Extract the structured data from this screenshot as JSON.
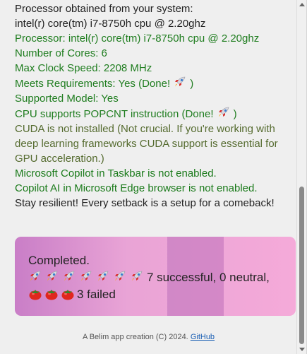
{
  "log": [
    {
      "text": "Processor obtained from your system:",
      "color": "#222222"
    },
    {
      "text": "intel(r) core(tm) i7-8750h cpu @ 2.20ghz",
      "color": "#222222"
    },
    {
      "text": "Processor: intel(r) core(tm) i7-8750h cpu @ 2.20ghz",
      "color": "#1f7d1f"
    },
    {
      "text": "Number of Cores: 6",
      "color": "#1f7d1f"
    },
    {
      "text": "Max Clock Speed: 2208 MHz",
      "color": "#1f7d1f"
    },
    {
      "text": "Meets Requirements: Yes (Done! ",
      "suffix": ")",
      "icon": "rocket-icon",
      "color": "#1f7d1f"
    },
    {
      "text": "Supported Model: Yes",
      "color": "#1f7d1f"
    },
    {
      "text": "CPU supports POPCNT instruction (Done! ",
      "suffix": ")",
      "icon": "rocket-icon",
      "color": "#1f7d1f"
    },
    {
      "text": "CUDA is not installed (Not crucial. If you're working with deep learning frameworks CUDA support is essential for GPU acceleration.)",
      "color": "#556b2f"
    },
    {
      "text": "Microsoft Copilot in Taskbar is not enabled.",
      "color": "#1a7a1a"
    },
    {
      "text": "Copilot AI in Microsoft Edge browser is not enabled.",
      "color": "#1a7a1a"
    },
    {
      "text": "Stay resilient! Every setback is a setup for a comeback!",
      "color": "#222222"
    }
  ],
  "summary": {
    "title": "Completed.",
    "rocket_count": 7,
    "successful_text": "7 successful, 0 neutral,",
    "tomato_count": 3,
    "failed_text": "3 failed",
    "success_icon": "rocket-icon",
    "failed_icon": "tomato-icon"
  },
  "footer": {
    "text": "A Belim app creation (C) 2024.",
    "link_label": "GitHub"
  }
}
